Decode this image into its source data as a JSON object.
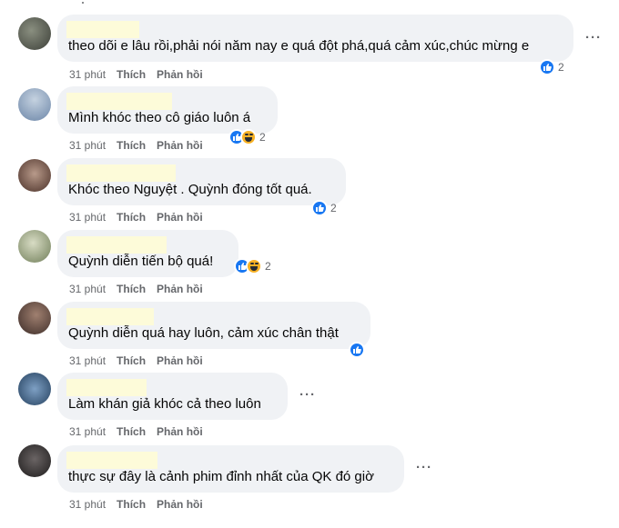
{
  "comments": [
    {
      "text": "theo dõi e lâu rồi,phải nói năm nay e quá đột phá,quá cảm xúc,chúc mừng e",
      "time": "31 phút",
      "like": "Thích",
      "reply": "Phản hồi",
      "reaction_count": "2",
      "reactions": [
        "like-icon"
      ],
      "avatar_color": "#5a5f52"
    },
    {
      "text": "Mình khóc theo cô giáo luôn á",
      "time": "31 phút",
      "like": "Thích",
      "reply": "Phản hồi",
      "reaction_count": "2",
      "reactions": [
        "like-icon",
        "haha-icon"
      ],
      "avatar_color": "#8aa0b8"
    },
    {
      "text": "Khóc theo Nguyệt . Quỳnh đóng tốt quá.",
      "time": "31 phút",
      "like": "Thích",
      "reply": "Phản hồi",
      "reaction_count": "2",
      "reactions": [
        "like-icon"
      ],
      "avatar_color": "#6b4c42"
    },
    {
      "text": "Quỳnh diễn tiến bộ quá!",
      "time": "31 phút",
      "like": "Thích",
      "reply": "Phản hồi",
      "reaction_count": "2",
      "reactions": [
        "like-icon",
        "haha-icon"
      ],
      "avatar_color": "#8a9a78"
    },
    {
      "text": "Quỳnh diễn quá hay luôn, cảm xúc chân thật",
      "time": "31 phút",
      "like": "Thích",
      "reply": "Phản hồi",
      "reaction_count": "",
      "reactions": [
        "like-icon"
      ],
      "avatar_color": "#5c4a44"
    },
    {
      "text": "Làm khán giả khóc cả theo luôn",
      "time": "31 phút",
      "like": "Thích",
      "reply": "Phản hồi",
      "reaction_count": "",
      "reactions": [],
      "avatar_color": "#4a6a8c"
    },
    {
      "text": "thực sự đây là cảnh phim đỉnh nhất của QK đó giờ",
      "time": "31 phút",
      "like": "Thích",
      "reply": "Phản hồi",
      "reaction_count": "",
      "reactions": [],
      "avatar_color": "#3a3838"
    }
  ],
  "colors": {
    "bubble": "#f0f2f5",
    "like_blue": "#1877f2",
    "meta": "#65676b",
    "name_highlight": "#fdfbd9"
  }
}
